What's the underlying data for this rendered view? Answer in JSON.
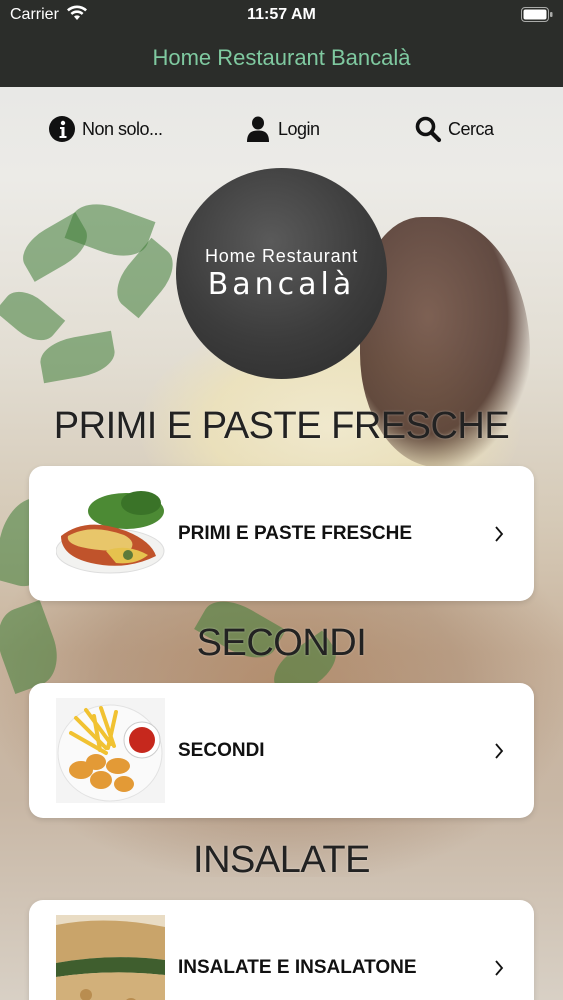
{
  "status_bar": {
    "carrier": "Carrier",
    "time": "11:57 AM",
    "wifi_icon": "wifi-icon",
    "battery_icon": "battery-icon"
  },
  "navbar": {
    "title": "Home Restaurant Bancalà",
    "title_color": "#7fc9a0",
    "background": "#2b2d2a"
  },
  "top_nav": [
    {
      "icon": "info-icon",
      "label": "Non solo..."
    },
    {
      "icon": "user-icon",
      "label": "Login"
    },
    {
      "icon": "search-icon",
      "label": "Cerca"
    }
  ],
  "logo": {
    "line1": "Home Restaurant",
    "line2": "Bancalà"
  },
  "sections": [
    {
      "title": "PRIMI E PASTE FRESCHE",
      "card_label": "PRIMI E PASTE FRESCHE",
      "thumb": "pasta-dish-image"
    },
    {
      "title": "SECONDI",
      "card_label": "SECONDI",
      "thumb": "fries-nuggets-image"
    },
    {
      "title": "INSALATE",
      "card_label": "INSALATE E INSALATONE",
      "thumb": "stuffed-bread-image"
    }
  ]
}
